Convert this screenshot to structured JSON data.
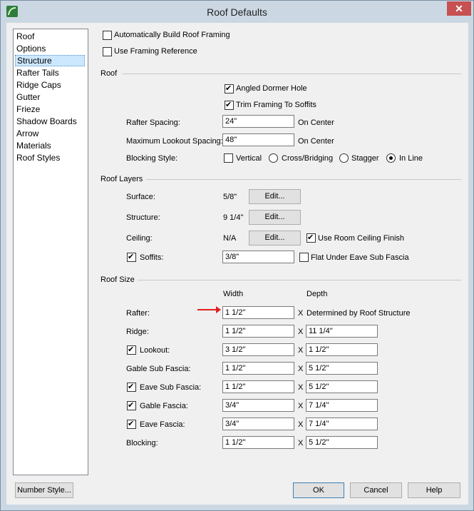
{
  "window": {
    "title": "Roof Defaults",
    "close": "✕"
  },
  "sidebar": {
    "items": [
      "Roof",
      "Options",
      "Structure",
      "Rafter Tails",
      "Ridge Caps",
      "Gutter",
      "Frieze",
      "Shadow Boards",
      "Arrow",
      "Materials",
      "Roof Styles"
    ],
    "selected": "Structure"
  },
  "top": {
    "auto_build": {
      "label": "Automatically Build Roof Framing",
      "checked": false
    },
    "framing_ref": {
      "label": "Use Framing Reference",
      "checked": false
    }
  },
  "roof": {
    "heading": "Roof",
    "angled_dormer": {
      "label": "Angled Dormer Hole",
      "checked": true
    },
    "trim_framing": {
      "label": "Trim Framing To Soffits",
      "checked": true
    },
    "rafter_spacing": {
      "label": "Rafter Spacing:",
      "value": "24\"",
      "unit": "On Center"
    },
    "max_lookout": {
      "label": "Maximum Lookout Spacing:",
      "value": "48\"",
      "unit": "On Center"
    },
    "blocking": {
      "label": "Blocking Style:",
      "vertical": "Vertical",
      "cross": "Cross/Bridging",
      "stagger": "Stagger",
      "inline": "In Line",
      "selected": "In Line"
    }
  },
  "layers": {
    "heading": "Roof Layers",
    "surface": {
      "label": "Surface:",
      "value": "5/8\"",
      "edit": "Edit..."
    },
    "structure": {
      "label": "Structure:",
      "value": "9 1/4\"",
      "edit": "Edit..."
    },
    "ceiling": {
      "label": "Ceiling:",
      "value": "N/A",
      "edit": "Edit...",
      "room_ceiling": "Use Room Ceiling Finish",
      "room_checked": true
    },
    "soffits": {
      "label": "Soffits:",
      "checked": true,
      "value": "3/8\"",
      "flat_under": "Flat Under Eave Sub Fascia",
      "flat_checked": false
    }
  },
  "size": {
    "heading": "Roof Size",
    "width_header": "Width",
    "depth_header": "Depth",
    "x": "X",
    "rows": [
      {
        "label": "Rafter:",
        "checkbox": false,
        "width": "1 1/2\"",
        "depth": "Determined by Roof Structure",
        "depth_is_text": true
      },
      {
        "label": "Ridge:",
        "checkbox": false,
        "width": "1 1/2\"",
        "depth": "11 1/4\""
      },
      {
        "label": "Lookout:",
        "checkbox": true,
        "width": "3 1/2\"",
        "depth": "1 1/2\""
      },
      {
        "label": "Gable Sub Fascia:",
        "checkbox": false,
        "width": "1 1/2\"",
        "depth": "5 1/2\""
      },
      {
        "label": "Eave Sub Fascia:",
        "checkbox": true,
        "width": "1 1/2\"",
        "depth": "5 1/2\""
      },
      {
        "label": "Gable Fascia:",
        "checkbox": true,
        "width": "3/4\"",
        "depth": "7 1/4\""
      },
      {
        "label": "Eave Fascia:",
        "checkbox": true,
        "width": "3/4\"",
        "depth": "7 1/4\""
      },
      {
        "label": "Blocking:",
        "checkbox": false,
        "width": "1 1/2\"",
        "depth": "5 1/2\""
      }
    ]
  },
  "footer": {
    "number_style": "Number Style...",
    "ok": "OK",
    "cancel": "Cancel",
    "help": "Help"
  },
  "colors": {
    "accent_arrow": "#e02020",
    "selection": "#cce8ff"
  }
}
